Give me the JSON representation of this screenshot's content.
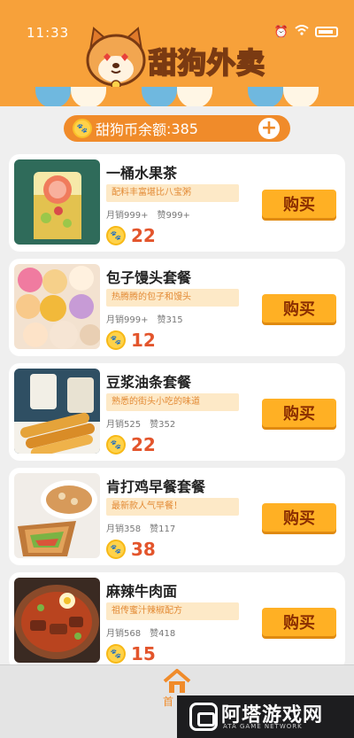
{
  "status_bar": {
    "time": "11:33"
  },
  "header": {
    "title": "甜狗外卖"
  },
  "balance": {
    "label": "甜狗币余额",
    "separator": ":",
    "value": "385"
  },
  "items": [
    {
      "name": "一桶水果茶",
      "tag": "配料丰富堪比八宝粥",
      "monthly": "月销999+",
      "likes": "赞999+",
      "price": "22",
      "buy": "购买"
    },
    {
      "name": "包子馒头套餐",
      "tag": "热腾腾的包子和馒头",
      "monthly": "月销999+",
      "likes": "赞315",
      "price": "12",
      "buy": "购买"
    },
    {
      "name": "豆浆油条套餐",
      "tag": "熟悉的街头小吃的味道",
      "monthly": "月销525",
      "likes": "赞352",
      "price": "22",
      "buy": "购买"
    },
    {
      "name": "肯打鸡早餐套餐",
      "tag": "最新款人气早餐！",
      "monthly": "月销358",
      "likes": "赞117",
      "price": "38",
      "buy": "购买"
    },
    {
      "name": "麻辣牛肉面",
      "tag": "祖传蜜汁辣椒配方",
      "monthly": "月销568",
      "likes": "赞418",
      "price": "15",
      "buy": "购买"
    }
  ],
  "nav": {
    "home_label": "首"
  },
  "watermark": {
    "title": "阿塔游戏网",
    "subtitle": "ATA GAME NETWORK"
  },
  "colors": {
    "header": "#f7a13a",
    "accent": "#f08b2a",
    "buy": "#ffb024",
    "price": "#e3552c"
  }
}
